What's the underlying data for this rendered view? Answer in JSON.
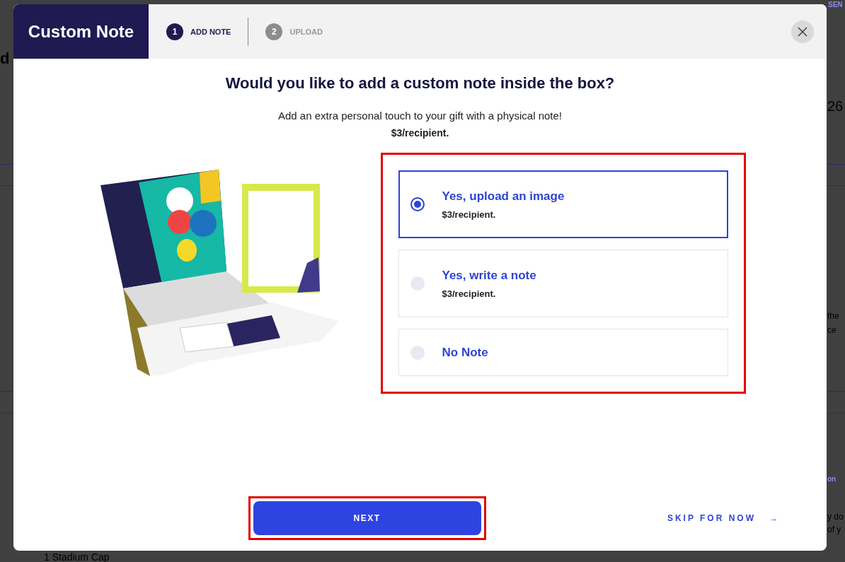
{
  "background_page": {
    "fragments": [
      {
        "text": "SEN",
        "kind": "link"
      },
      {
        "text": "d",
        "kind": "heading"
      },
      {
        "text": "26",
        "kind": "large"
      },
      {
        "text": "the",
        "kind": "body"
      },
      {
        "text": "ce",
        "kind": "body"
      },
      {
        "text": "on",
        "kind": "link"
      },
      {
        "text": "y do",
        "kind": "body"
      },
      {
        "text": "of y",
        "kind": "body"
      },
      {
        "text": "1 Stadium Cap",
        "kind": "body"
      }
    ]
  },
  "modal": {
    "title": "Custom Note",
    "steps": [
      {
        "number": "1",
        "label": "ADD NOTE",
        "selected": true
      },
      {
        "number": "2",
        "label": "UPLOAD",
        "selected": false
      }
    ],
    "question": "Would you like to add a custom note inside the box?",
    "subtitle": "Add an extra personal touch to your gift with a physical note!",
    "price_note": "$3/recipient.",
    "options_highlighted": true,
    "options": [
      {
        "label": "Yes, upload an image",
        "price": "$3/recipient.",
        "selected": true
      },
      {
        "label": "Yes, write a note",
        "price": "$3/recipient.",
        "selected": false
      },
      {
        "label": "No Note",
        "selected": false
      }
    ],
    "next_button": {
      "label": "NEXT",
      "highlighted": true
    },
    "skip_link": {
      "label": "SKIP FOR NOW",
      "arrow": "→"
    }
  }
}
